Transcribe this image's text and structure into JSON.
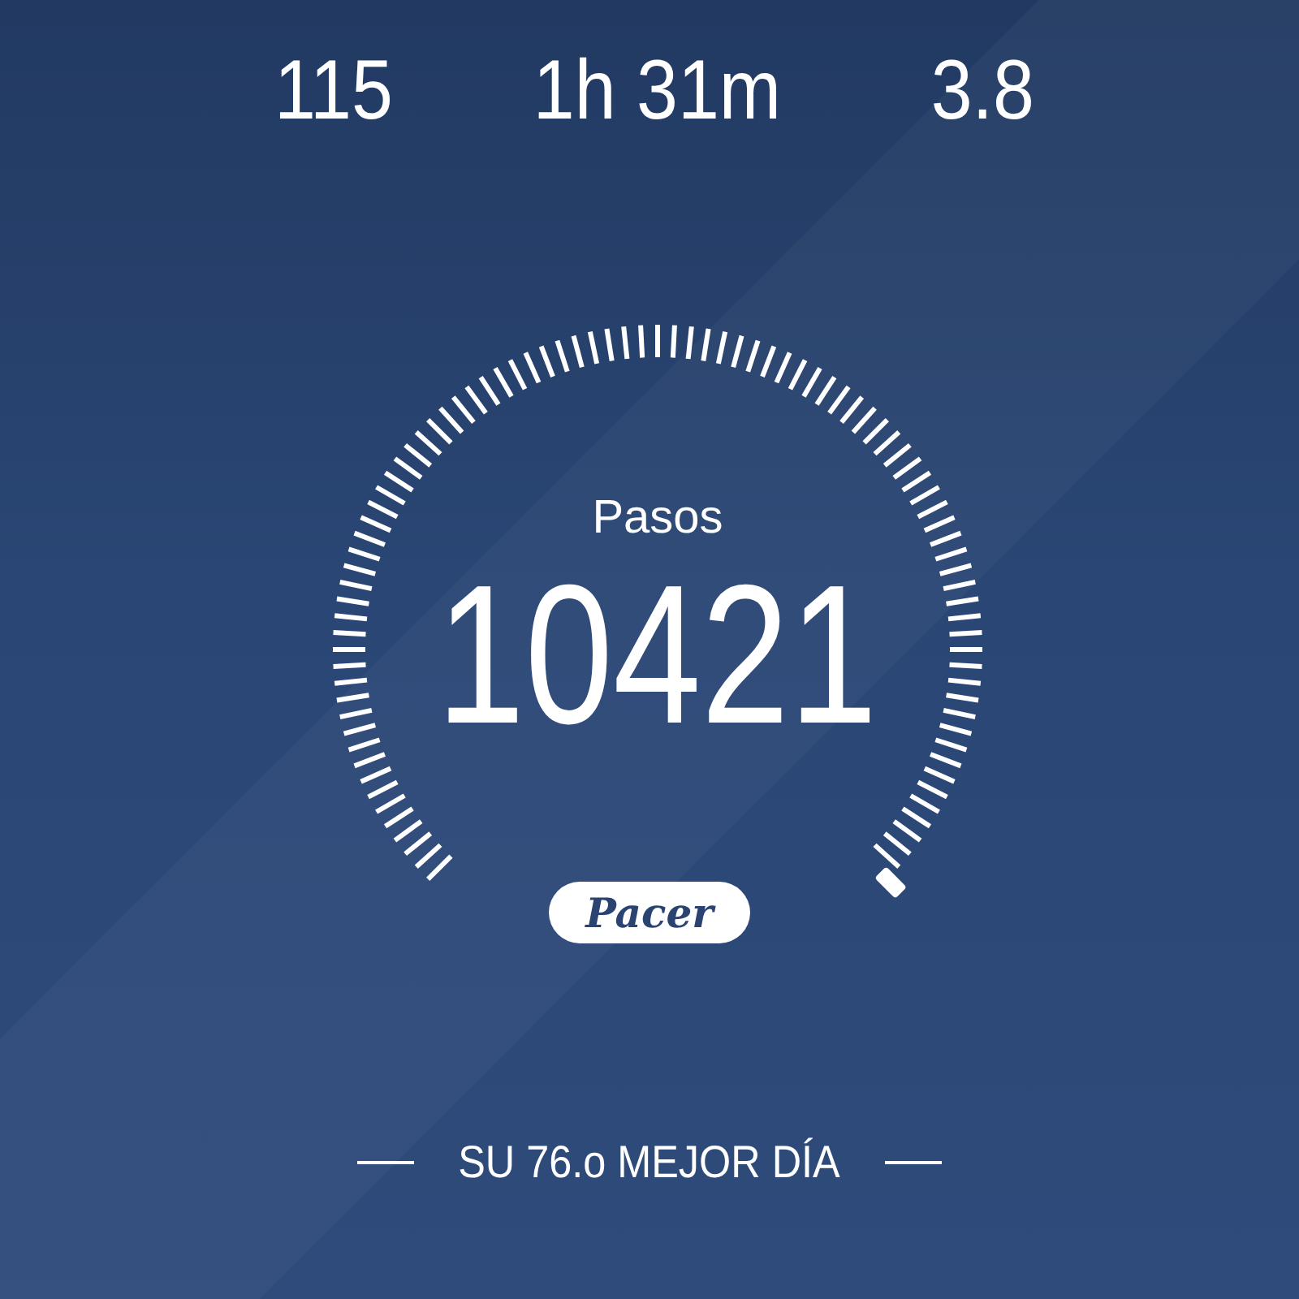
{
  "stats": [
    {
      "value": "115"
    },
    {
      "value": "1h 31m"
    },
    {
      "value": "3.8"
    }
  ],
  "gauge": {
    "label": "Pasos",
    "value": "10421"
  },
  "logo": "Pacer",
  "rank": "SU 76.o MEJOR DÍA"
}
